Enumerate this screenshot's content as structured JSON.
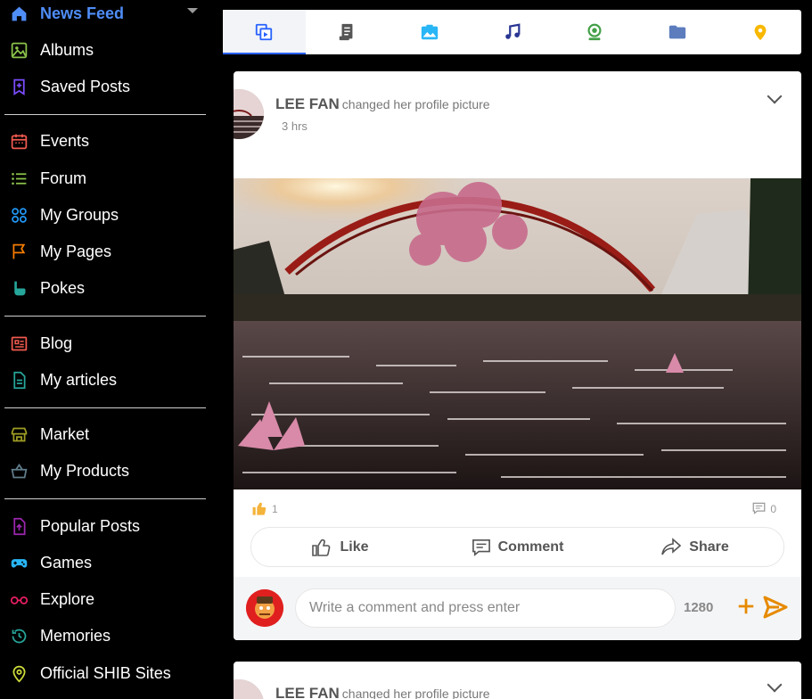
{
  "sidebar": {
    "items": [
      {
        "label": "News Feed",
        "icon": "home-icon",
        "color": "#4f8df7"
      },
      {
        "label": "Albums",
        "icon": "image-icon",
        "color": "#8bc34a"
      },
      {
        "label": "Saved Posts",
        "icon": "bookmark-icon",
        "color": "#7b4cff"
      },
      {
        "label": "Events",
        "icon": "calendar-icon",
        "color": "#f05a4f"
      },
      {
        "label": "Forum",
        "icon": "list-icon",
        "color": "#8bc34a"
      },
      {
        "label": "My Groups",
        "icon": "groups-icon",
        "color": "#2196f3"
      },
      {
        "label": "My Pages",
        "icon": "flag-icon",
        "color": "#f57c00"
      },
      {
        "label": "Pokes",
        "icon": "poke-hand-icon",
        "color": "#26a69a"
      },
      {
        "label": "Blog",
        "icon": "blog-icon",
        "color": "#f05a4f"
      },
      {
        "label": "My articles",
        "icon": "article-icon",
        "color": "#26a69a"
      },
      {
        "label": "Market",
        "icon": "store-icon",
        "color": "#9e9d24"
      },
      {
        "label": "My Products",
        "icon": "basket-icon",
        "color": "#607d8b"
      },
      {
        "label": "Popular Posts",
        "icon": "popular-icon",
        "color": "#9c27b0"
      },
      {
        "label": "Games",
        "icon": "gamepad-icon",
        "color": "#29b6f6"
      },
      {
        "label": "Explore",
        "icon": "glasses-icon",
        "color": "#e91e63"
      },
      {
        "label": "Memories",
        "icon": "history-icon",
        "color": "#26a69a"
      },
      {
        "label": "Official SHIB Sites",
        "icon": "location-pin-icon",
        "color": "#cddc39"
      }
    ]
  },
  "tabs": [
    {
      "icon": "media-icon",
      "color": "#2962ff"
    },
    {
      "icon": "document-icon",
      "color": "#555555"
    },
    {
      "icon": "photo-icon",
      "color": "#29b6f6"
    },
    {
      "icon": "music-icon",
      "color": "#283593"
    },
    {
      "icon": "webcam-icon",
      "color": "#43a047"
    },
    {
      "icon": "folder-icon",
      "color": "#5c7cbe"
    },
    {
      "icon": "map-pin-icon",
      "color": "#f9b800"
    }
  ],
  "posts": [
    {
      "author": "LEE FAN",
      "action": "changed her profile picture",
      "time": "3 hrs",
      "likes": "1",
      "comments": "0"
    },
    {
      "author": "LEE FAN",
      "action": "changed her profile picture"
    }
  ],
  "actions": {
    "like": "Like",
    "comment": "Comment",
    "share": "Share"
  },
  "composer": {
    "placeholder": "Write a comment and press enter",
    "char_limit": "1280"
  },
  "colors": {
    "accent": "#4f8df7",
    "orange": "#e68a00"
  }
}
